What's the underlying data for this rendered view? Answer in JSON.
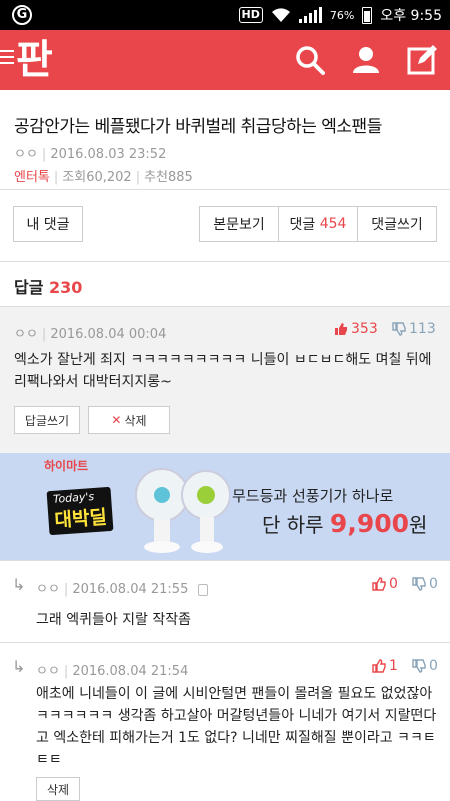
{
  "status_bar": {
    "logo": "G",
    "hd": "HD",
    "battery": "76%",
    "time": "오후 9:55"
  },
  "app": {
    "brand": "판"
  },
  "post": {
    "title": "공감안가는 베플됐다가 바퀴벌레 취급당하는 엑소팬들",
    "author": "ㅇㅇ",
    "date": "2016.08.03 23:52",
    "category": "엔터톡",
    "views": "조회60,202",
    "recommend": "추천885"
  },
  "actions": {
    "my_comments": "내 댓글",
    "view_body": "본문보기",
    "comments_label": "댓글",
    "comments_count": "454",
    "write_comment": "댓글쓰기"
  },
  "replies_header": {
    "label": "답글",
    "count": "230"
  },
  "best_comment": {
    "author": "ㅇㅇ",
    "date": "2016.08.04 00:04",
    "likes": "353",
    "dislikes": "113",
    "text": "엑소가 잘난게 죄지 ㅋㅋㅋㅋㅋㅋㅋㅋㅋ 니들이 ㅂㄷㅂㄷ해도 며칠 뒤에 리팩나와서 대박터지지롱~",
    "reply_button": "답글쓰기",
    "delete_button": "삭제"
  },
  "ad": {
    "brand": "하이마트",
    "badge_top": "Today's",
    "badge_main": "대박딜",
    "line1": "무드등과 선풍기가 하나로",
    "line2_prefix": "단 하루",
    "price": "9,900",
    "currency": "원"
  },
  "replies": [
    {
      "author": "ㅇㅇ",
      "date": "2016.08.04 21:55",
      "likes": "0",
      "dislikes": "0",
      "text": "그래 엑퀴들아 지랄 작작좀"
    },
    {
      "author": "ㅇㅇ",
      "date": "2016.08.04 21:54",
      "likes": "1",
      "dislikes": "0",
      "text": "애초에 니네들이 이 글에 시비안털면 팬들이 몰려올 필요도 없었잖아 ㅋㅋㅋㅋㅋㅋ 생각좀 하고살아 머갈텅년들아 니네가 여기서 지랄떤다고 엑소한테 피해가는거 1도 없다? 니네만 찌질해질 뿐이라고 ㅋㅋㅌㅌㅌ",
      "delete_button": "삭제"
    }
  ],
  "colors": {
    "accent": "#e8464a",
    "ad_price": "#e8464a"
  }
}
